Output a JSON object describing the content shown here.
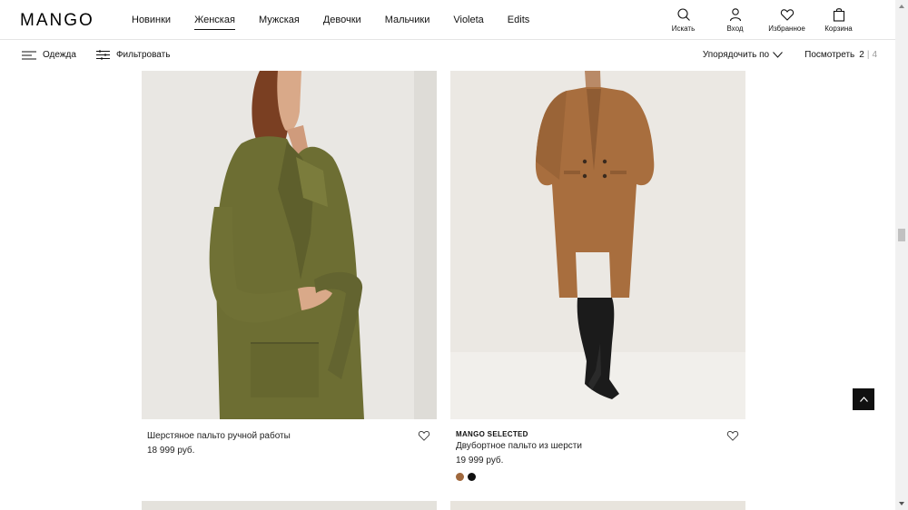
{
  "header": {
    "logo": "MANGO",
    "nav": [
      "Новинки",
      "Женская",
      "Мужская",
      "Девочки",
      "Мальчики",
      "Violeta",
      "Edits"
    ],
    "active_nav": "Женская",
    "tools": {
      "search": "Искать",
      "login": "Вход",
      "favorites": "Избранное",
      "cart": "Корзина"
    }
  },
  "subbar": {
    "category": "Одежда",
    "filter": "Фильтровать",
    "sort": "Упорядочить по",
    "view_label": "Посмотреть",
    "view_options": [
      "2",
      "4"
    ]
  },
  "products": [
    {
      "brand": "",
      "name": "Шерстяное пальто ручной работы",
      "price": "18 999 руб.",
      "image": "olive-wool-coat"
    },
    {
      "brand": "MANGO SELECTED",
      "name": "Двубортное пальто из шерсти",
      "price": "19 999 руб.",
      "image": "camel-double-breasted-coat",
      "swatches": [
        "#a0683d",
        "#111111"
      ]
    }
  ],
  "colors": {
    "text": "#111111",
    "border": "#e5e5e5"
  }
}
